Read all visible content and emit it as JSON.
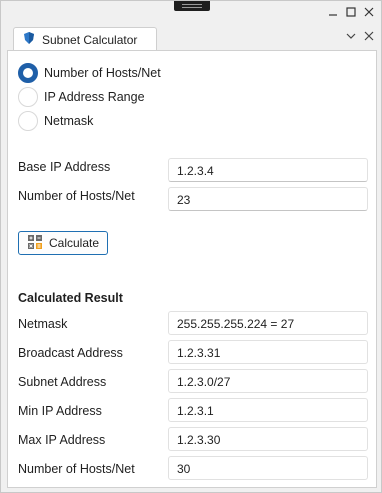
{
  "tab": {
    "title": "Subnet Calculator",
    "icon": "shield-icon"
  },
  "mode": {
    "options": [
      "Number of Hosts/Net",
      "IP Address Range",
      "Netmask"
    ],
    "selected_index": 0
  },
  "inputs": {
    "base_ip_label": "Base IP Address",
    "base_ip_value": "1.2.3.4",
    "hosts_label": "Number of Hosts/Net",
    "hosts_value": "23"
  },
  "calculate_button": {
    "label": "Calculate",
    "icon": "calculator-icon"
  },
  "result": {
    "title": "Calculated Result",
    "rows": [
      {
        "label": "Netmask",
        "value": "255.255.255.224 = 27"
      },
      {
        "label": "Broadcast Address",
        "value": "1.2.3.31"
      },
      {
        "label": "Subnet Address",
        "value": "1.2.3.0/27"
      },
      {
        "label": "Min IP Address",
        "value": "1.2.3.1"
      },
      {
        "label": "Max IP Address",
        "value": "1.2.3.30"
      },
      {
        "label": "Number of Hosts/Net",
        "value": "30"
      }
    ]
  },
  "colors": {
    "accent": "#1f5fa8",
    "button_border": "#1f6fb2"
  }
}
